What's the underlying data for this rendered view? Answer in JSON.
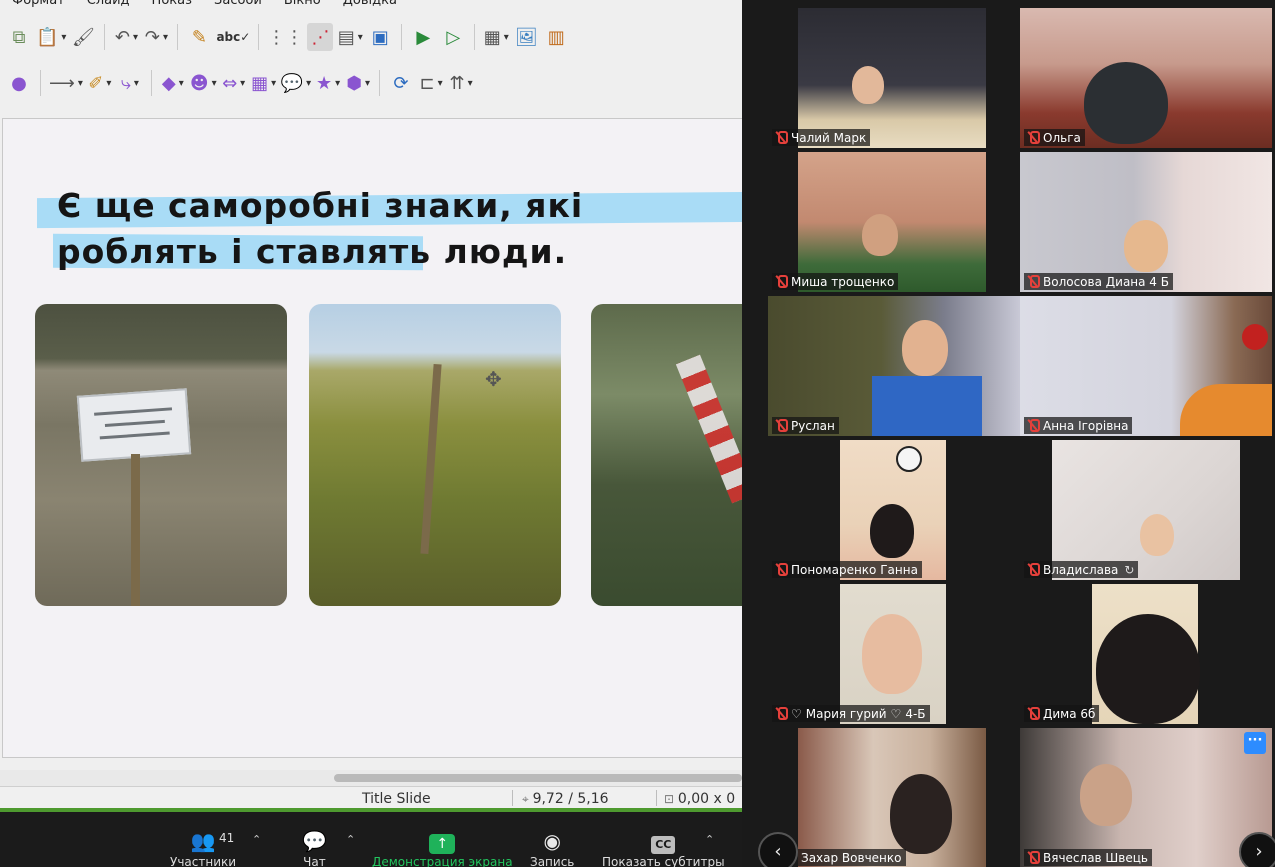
{
  "menubar": [
    "Формат",
    "Слайд",
    "Показ",
    "Засоби",
    "Вікно",
    "Довідка"
  ],
  "slide": {
    "title": "Є ще саморобні знаки, які роблять і ставлять люди."
  },
  "statusbar": {
    "layout": "Title Slide",
    "position": "9,72 / 5,16",
    "size": "0,00 x 0"
  },
  "zoom_bar": {
    "participants_label": "Участники",
    "participants_count": "41",
    "chat_label": "Чат",
    "share_label": "Демонстрация экрана",
    "record_label": "Запись",
    "subtitles_label": "Показать субтитры",
    "cc_text": "CC"
  },
  "participants": [
    {
      "name": "Чалий Марк",
      "muted": true
    },
    {
      "name": "Ольга",
      "muted": true
    },
    {
      "name": "Миша трощенко",
      "muted": true
    },
    {
      "name": "Волосова Диана 4 Б",
      "muted": true
    },
    {
      "name": "Руслан",
      "muted": true
    },
    {
      "name": "Анна Ігорівна",
      "muted": true
    },
    {
      "name": "Пономаренко Ганна",
      "muted": true
    },
    {
      "name": "Владислава",
      "muted": true
    },
    {
      "name": "Мария гурий",
      "suffix": "4-Б",
      "muted": true
    },
    {
      "name": "Дима 6б",
      "muted": true
    },
    {
      "name": "Захар Вовченко",
      "muted": false
    },
    {
      "name": "Вячеслав Швець",
      "muted": true
    }
  ],
  "gallery": {
    "more_text": "···",
    "prev": "‹",
    "next": "›"
  },
  "colors": {
    "title_highlight": "#a9dcf6",
    "accent_green": "#4e9a2f",
    "share_green": "#1fb25a",
    "mic_off_red": "#e5403b",
    "zoom_blue": "#2d8cff"
  }
}
